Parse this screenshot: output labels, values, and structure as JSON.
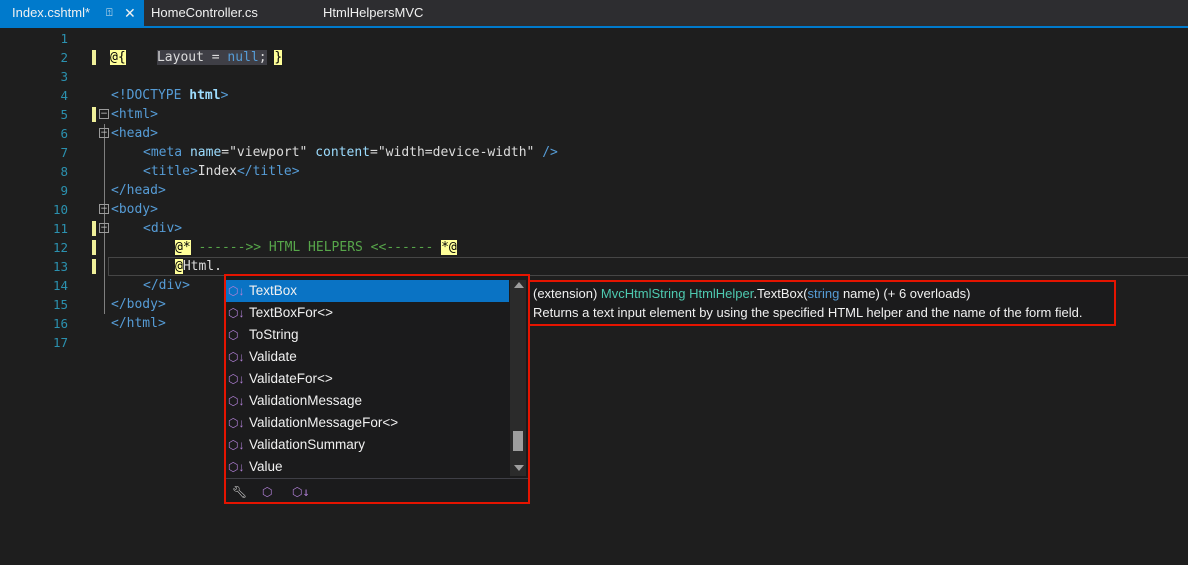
{
  "tabs": [
    {
      "label": "Index.cshtml*",
      "active": true,
      "pin_icon": "pin-icon",
      "close_icon": "close-icon"
    },
    {
      "label": "HomeController.cs",
      "active": false
    },
    {
      "label": "HtmlHelpersMVC",
      "active": false
    }
  ],
  "editor": {
    "line_numbers": [
      "1",
      "2",
      "3",
      "4",
      "5",
      "6",
      "7",
      "8",
      "9",
      "10",
      "11",
      "12",
      "13",
      "14",
      "15",
      "16",
      "17"
    ],
    "code": {
      "l2_open": "@{",
      "l2_body": "Layout = ",
      "l2_null": "null",
      "l2_semi": ";",
      "l2_close": "}",
      "l4_doctype": "<!DOCTYPE ",
      "l4_html": "html",
      "l4_end": ">",
      "l5": "<html>",
      "l6": "<head>",
      "l7_open": "<meta ",
      "l7_name_attr": "name",
      "l7_eq1": "=",
      "l7_name_val": "\"viewport\"",
      "l7_content_attr": "content",
      "l7_eq2": "=",
      "l7_content_val": "\"width=device-width\"",
      "l7_close": " />",
      "l8_open": "<title>",
      "l8_text": "Index",
      "l8_close": "</title>",
      "l9": "</head>",
      "l10": "<body>",
      "l11": "<div>",
      "l12_open": "@*",
      "l12_comment": " ------>> HTML HELPERS <<------ ",
      "l12_close": "*@",
      "l13_at": "@",
      "l13_text": "Html.",
      "l14": "</div>",
      "l15": "</body>",
      "l16": "</html>"
    }
  },
  "intellisense": {
    "items": [
      {
        "label": "TextBox",
        "icon": "extension-method-icon",
        "selected": true
      },
      {
        "label": "TextBoxFor<>",
        "icon": "extension-method-icon",
        "selected": false
      },
      {
        "label": "ToString",
        "icon": "method-icon",
        "selected": false
      },
      {
        "label": "Validate",
        "icon": "extension-method-icon",
        "selected": false
      },
      {
        "label": "ValidateFor<>",
        "icon": "extension-method-icon",
        "selected": false
      },
      {
        "label": "ValidationMessage",
        "icon": "extension-method-icon",
        "selected": false
      },
      {
        "label": "ValidationMessageFor<>",
        "icon": "extension-method-icon",
        "selected": false
      },
      {
        "label": "ValidationSummary",
        "icon": "extension-method-icon",
        "selected": false
      },
      {
        "label": "Value",
        "icon": "extension-method-icon",
        "selected": false
      }
    ],
    "filters": [
      "wrench-filter-icon",
      "method-filter-icon",
      "extension-filter-icon"
    ]
  },
  "tooltip": {
    "prefix": "(extension) ",
    "return_type": "MvcHtmlString",
    "space": " ",
    "class_name": "HtmlHelper",
    "method": ".TextBox(",
    "param_type": "string",
    "param_rest": " name) (+ 6 overloads)",
    "description": "Returns a text input element by using the specified HTML helper and the name of the form field."
  },
  "colors": {
    "accent": "#007acc",
    "highlight_box": "#e51400",
    "selection": "#0a73c4"
  }
}
